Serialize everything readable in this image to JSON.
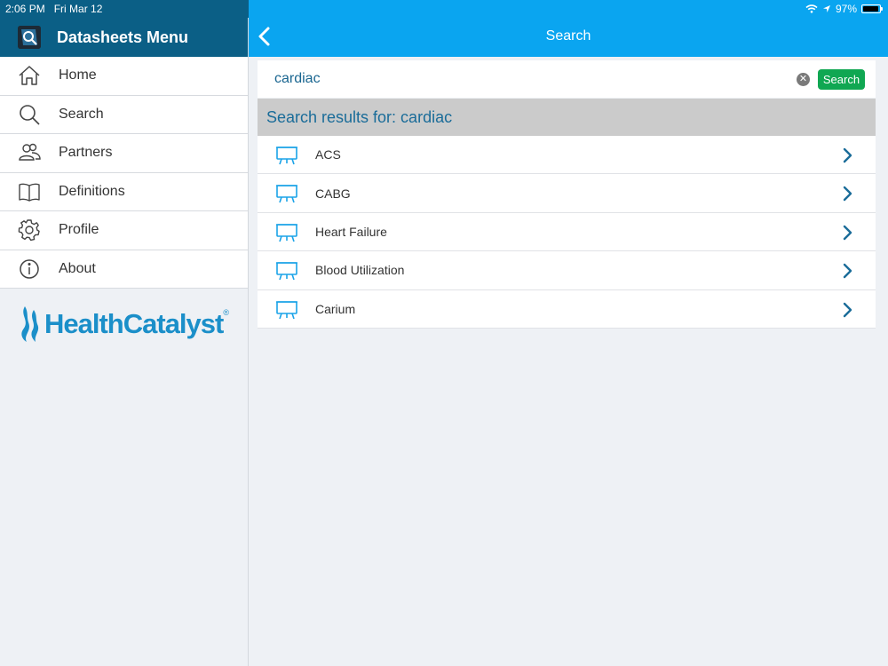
{
  "status": {
    "time": "2:06 PM",
    "date": "Fri Mar 12",
    "battery": "97%",
    "battery_level": 0.97
  },
  "sidebar": {
    "title": "Datasheets Menu",
    "items": [
      {
        "label": "Home",
        "icon": "home-icon"
      },
      {
        "label": "Search",
        "icon": "search-icon"
      },
      {
        "label": "Partners",
        "icon": "partners-icon"
      },
      {
        "label": "Definitions",
        "icon": "book-icon"
      },
      {
        "label": "Profile",
        "icon": "gear-icon"
      },
      {
        "label": "About",
        "icon": "info-icon"
      }
    ],
    "brand": "HealthCatalyst",
    "brand_mark": "®"
  },
  "header": {
    "title": "Search"
  },
  "search": {
    "value": "cardiac",
    "button_label": "Search",
    "clear_glyph": "✕"
  },
  "results": {
    "heading": "Search results for: cardiac",
    "items": [
      {
        "label": "ACS"
      },
      {
        "label": "CABG"
      },
      {
        "label": "Heart Failure"
      },
      {
        "label": "Blood Utilization"
      },
      {
        "label": "Carium"
      }
    ]
  },
  "colors": {
    "sidebar_header": "#0b5f86",
    "topbar": "#0aa5f0",
    "search_button": "#10a752",
    "accent_text": "#1a6c99",
    "chevron": "#1a6c99",
    "result_icon": "#1aa3e8"
  }
}
